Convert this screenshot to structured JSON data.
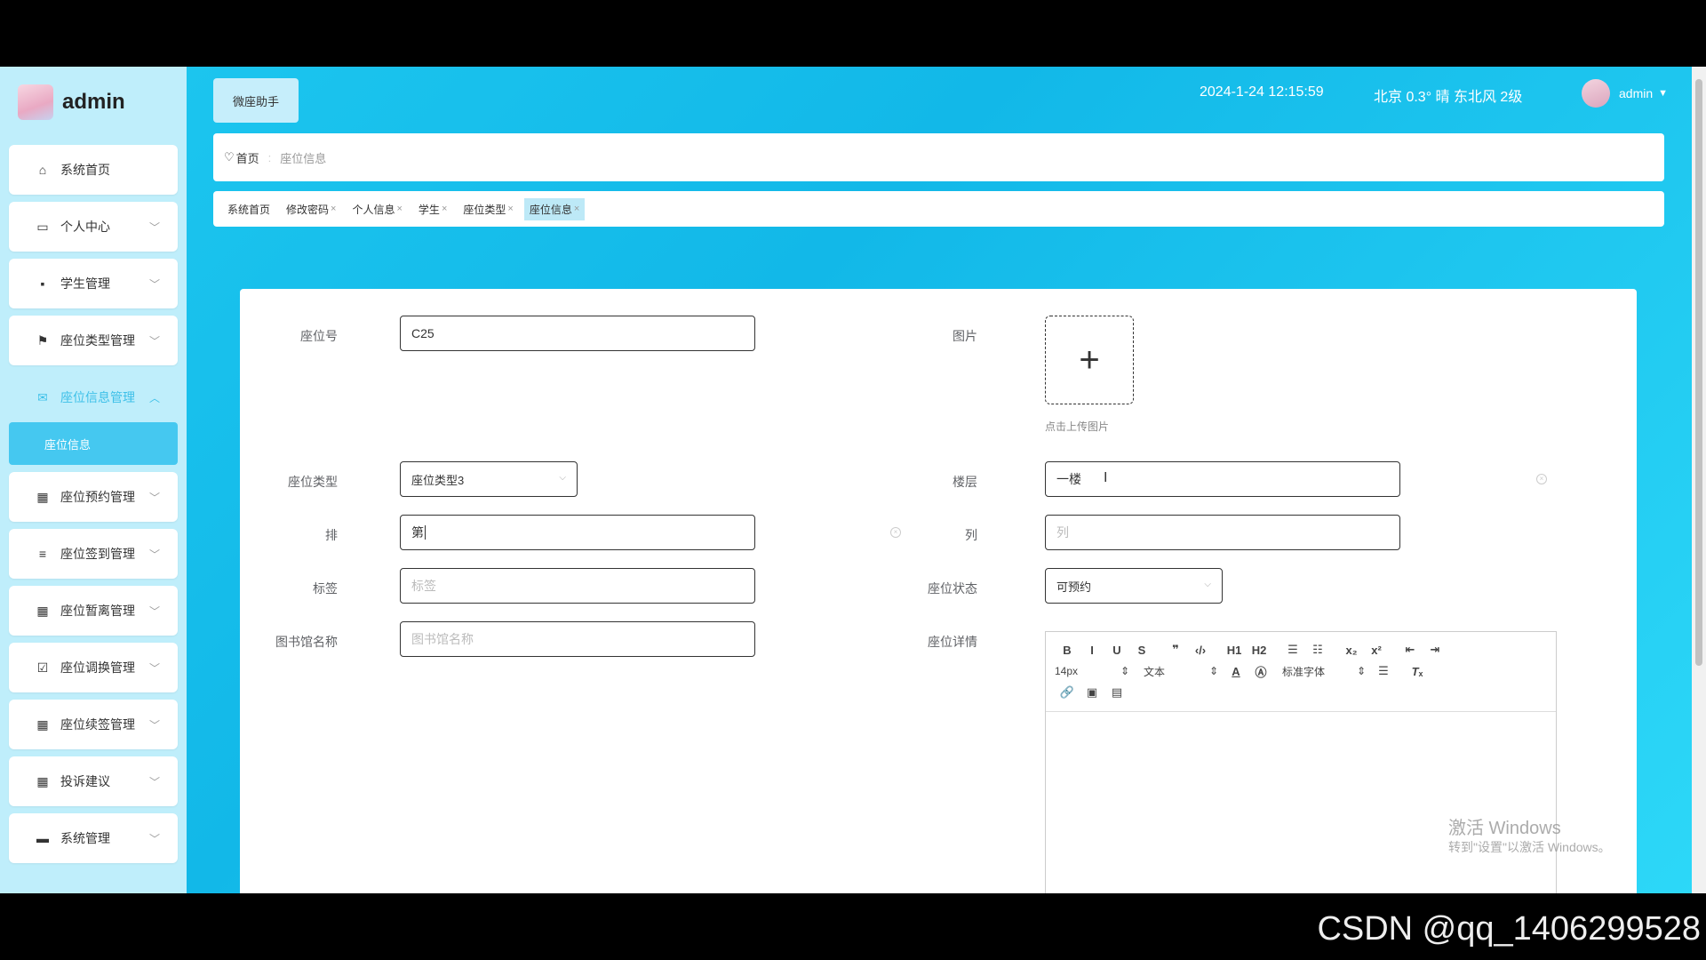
{
  "brand": {
    "name": "admin"
  },
  "sidebar": {
    "items": [
      {
        "label": "系统首页",
        "icon": "home-icon",
        "glyph": "⌂",
        "expandable": false
      },
      {
        "label": "个人中心",
        "icon": "calendar-icon",
        "glyph": "▭",
        "expandable": true
      },
      {
        "label": "学生管理",
        "icon": "chat-icon",
        "glyph": "▪",
        "expandable": true
      },
      {
        "label": "座位类型管理",
        "icon": "flag-icon",
        "glyph": "⚑",
        "expandable": true
      },
      {
        "label": "座位信息管理",
        "icon": "ticket-icon",
        "glyph": "✉",
        "expandable": true,
        "active": true,
        "sub": "座位信息"
      },
      {
        "label": "座位预约管理",
        "icon": "grid-icon",
        "glyph": "▦",
        "expandable": true
      },
      {
        "label": "座位签到管理",
        "icon": "sliders-icon",
        "glyph": "≡",
        "expandable": true
      },
      {
        "label": "座位暂离管理",
        "icon": "apps-icon",
        "glyph": "▦",
        "expandable": true
      },
      {
        "label": "座位调换管理",
        "icon": "clipboard-check-icon",
        "glyph": "☑",
        "expandable": true
      },
      {
        "label": "座位续签管理",
        "icon": "grid-icon",
        "glyph": "▦",
        "expandable": true
      },
      {
        "label": "投诉建议",
        "icon": "grid-icon",
        "glyph": "▦",
        "expandable": true
      },
      {
        "label": "系统管理",
        "icon": "monitor-icon",
        "glyph": "▬",
        "expandable": true
      }
    ]
  },
  "header": {
    "assistant": "微座助手",
    "datetime": "2024-1-24 12:15:59",
    "weather": "北京 0.3° 晴 东北风 2级",
    "user": "admin"
  },
  "breadcrumb": {
    "home": "首页",
    "current": "座位信息"
  },
  "tabs": [
    {
      "label": "系统首页",
      "closable": false
    },
    {
      "label": "修改密码",
      "closable": true
    },
    {
      "label": "个人信息",
      "closable": true
    },
    {
      "label": "学生",
      "closable": true
    },
    {
      "label": "座位类型",
      "closable": true
    },
    {
      "label": "座位信息",
      "closable": true,
      "active": true
    }
  ],
  "form": {
    "seat_no": {
      "label": "座位号",
      "value": "C25"
    },
    "image": {
      "label": "图片",
      "hint": "点击上传图片"
    },
    "seat_type": {
      "label": "座位类型",
      "value": "座位类型3"
    },
    "floor": {
      "label": "楼层",
      "value": "一楼"
    },
    "row": {
      "label": "排",
      "value": "第"
    },
    "col": {
      "label": "列",
      "placeholder": "列"
    },
    "tag": {
      "label": "标签",
      "placeholder": "标签"
    },
    "status": {
      "label": "座位状态",
      "value": "可预约"
    },
    "library": {
      "label": "图书馆名称",
      "placeholder": "图书馆名称"
    },
    "detail": {
      "label": "座位详情"
    }
  },
  "editor": {
    "row1": [
      "B",
      "I",
      "U",
      "S",
      "❞",
      "‹/›",
      "H1",
      "H2",
      "☰",
      "☷",
      "x₂",
      "x²",
      "⇤",
      "⇥"
    ],
    "font_size": "14px",
    "text_type": "文本",
    "font_family": "标准字体",
    "row3": [
      "🔗",
      "▣",
      "▤"
    ]
  },
  "watermark": {
    "line1": "激活 Windows",
    "line2": "转到\"设置\"以激活 Windows。"
  },
  "footer_credit": "CSDN @qq_1406299528"
}
